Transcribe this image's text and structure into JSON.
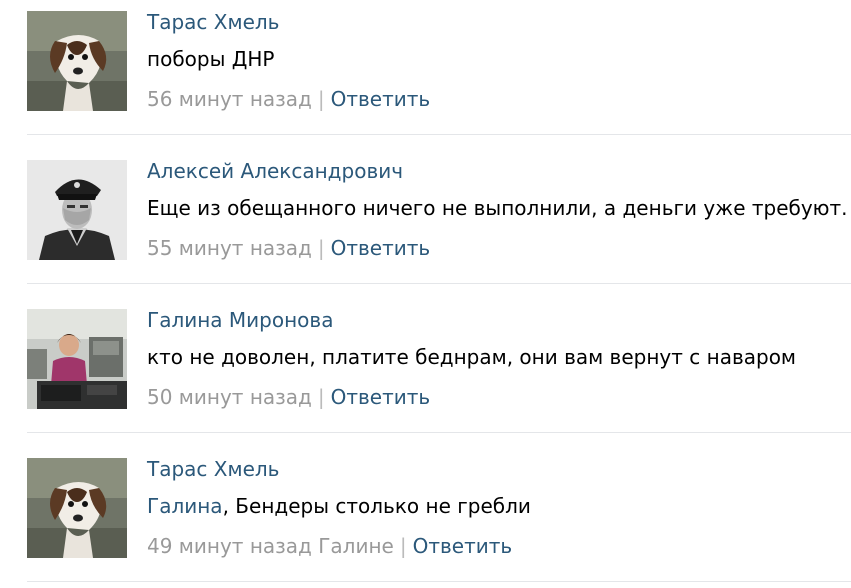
{
  "comments": [
    {
      "author": "Тарас Хмель",
      "avatar_icon": "puppy-avatar",
      "mention": "",
      "text": "поборы ДНР",
      "time": "56 минут назад",
      "reply_label": "Ответить"
    },
    {
      "author": "Алексей Александрович",
      "avatar_icon": "officer-portrait-avatar",
      "mention": "",
      "text": "Еще из обещанного ничего не выполнили, а деньги уже требуют.",
      "time": "55 минут назад",
      "reply_label": "Ответить"
    },
    {
      "author": "Галина Миронова",
      "avatar_icon": "woman-at-desk-avatar",
      "mention": "",
      "text": "кто не доволен, платите беднрам, они вам вернут с наваром",
      "time": "50 минут назад",
      "reply_label": "Ответить"
    },
    {
      "author": "Тарас Хмель",
      "avatar_icon": "puppy-avatar",
      "mention": "Галина",
      "text": ", Бендеры столько не гребли",
      "time": "49 минут назад Галине",
      "reply_label": "Ответить"
    }
  ],
  "colors": {
    "link": "#2b587a",
    "meta": "#999999",
    "divider": "#e4e6e9"
  }
}
